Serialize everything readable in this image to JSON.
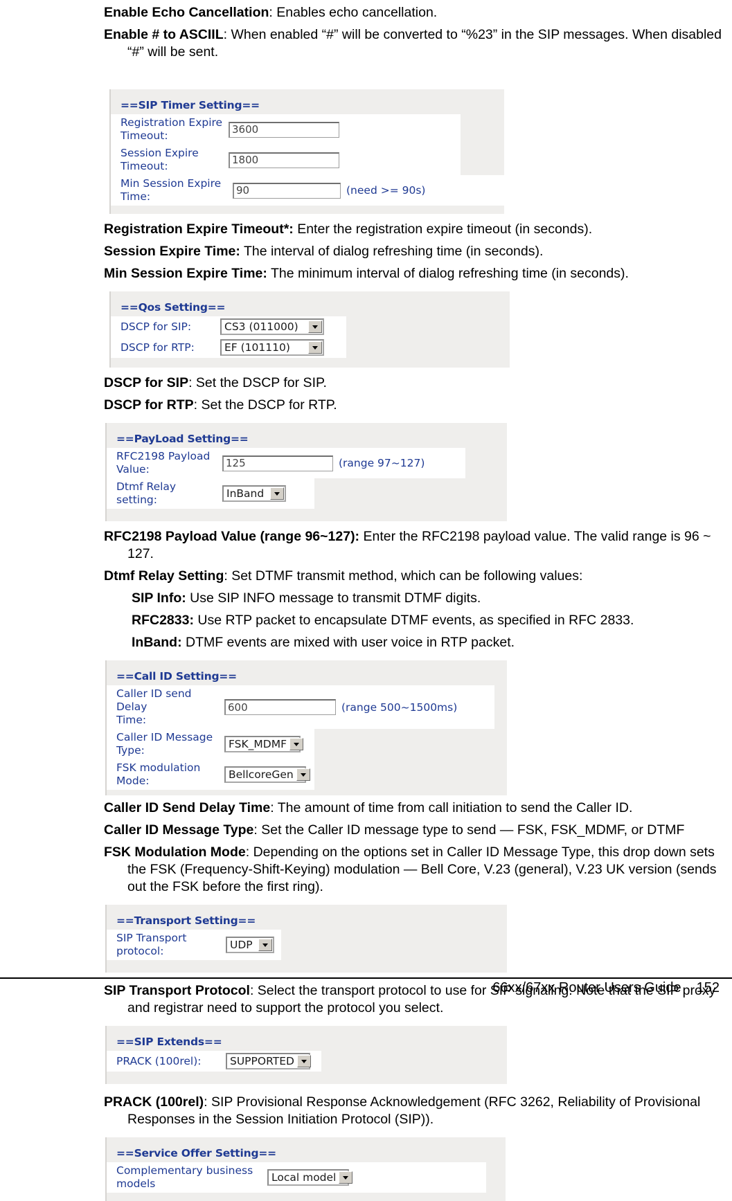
{
  "document": {
    "footer_title": "66xx/67xx Router Users Guide",
    "footer_page": "152"
  },
  "intro": {
    "echo_term": "Enable Echo Cancellation",
    "echo_desc": ": Enables echo cancellation.",
    "ascii_term": "Enable # to ASCIIL",
    "ascii_desc": ": When enabled “#” will be converted to “%23” in the SIP messages. When disabled “#” will be sent."
  },
  "sip_timer_panel": {
    "title": "==SIP Timer Setting==",
    "rows": [
      {
        "label": "Registration Expire\nTimeout:",
        "value": "3600",
        "hint": ""
      },
      {
        "label": "Session Expire Timeout:",
        "value": "1800",
        "hint": ""
      },
      {
        "label": "Min Session Expire Time:",
        "value": "90",
        "hint": "(need >= 90s)"
      }
    ]
  },
  "sip_timer_text": [
    {
      "term": "Registration Expire Timeout*:",
      "desc": " Enter the registration expire timeout (in seconds)."
    },
    {
      "term": "Session Expire Time:",
      "desc": " The interval of dialog refreshing time (in seconds)."
    },
    {
      "term": "Min Session Expire Time:",
      "desc": " The minimum interval of dialog refreshing time (in seconds)."
    }
  ],
  "qos_panel": {
    "title": "==Qos Setting==",
    "rows": [
      {
        "label": "DSCP for SIP:",
        "value": "CS3 (011000)"
      },
      {
        "label": "DSCP for RTP:",
        "value": "EF (101110)"
      }
    ]
  },
  "qos_text": [
    {
      "term": "DSCP for SIP",
      "desc": ": Set the DSCP for SIP."
    },
    {
      "term": "DSCP for RTP",
      "desc": ": Set the DSCP for RTP."
    }
  ],
  "payload_panel": {
    "title": "==PayLoad Setting==",
    "input_row": {
      "label": "RFC2198 Payload Value:",
      "value": "125",
      "hint": "(range 97~127)"
    },
    "select_row": {
      "label": "Dtmf Relay setting:",
      "value": "InBand"
    }
  },
  "payload_text": {
    "rfc_term": "RFC2198 Payload Value (range 96~127):",
    "rfc_desc": " Enter the RFC2198 payload value. The valid range is 96 ~ 127.",
    "dtmf_term": "Dtmf Relay Setting",
    "dtmf_desc": ": Set DTMF transmit method, which can be following values:",
    "options": [
      {
        "term": "SIP Info:",
        "desc": " Use SIP INFO message to transmit DTMF digits."
      },
      {
        "term": "RFC2833:",
        "desc": " Use RTP packet to encapsulate DTMF events, as specified in RFC 2833."
      },
      {
        "term": "InBand:",
        "desc": " DTMF events are mixed with user voice in RTP packet."
      }
    ]
  },
  "callid_panel": {
    "title": "==Call ID Setting==",
    "delay_row": {
      "label": "Caller ID send Delay\nTime:",
      "value": "600",
      "hint": "(range 500~1500ms)"
    },
    "type_row": {
      "label": "Caller ID Message Type:",
      "value": "FSK_MDMF"
    },
    "fsk_row": {
      "label": "FSK modulation Mode:",
      "value": "BellcoreGen"
    }
  },
  "callid_text": [
    {
      "term": "Caller ID Send Delay Time",
      "desc": ": The amount of time from call initiation to send the Caller ID."
    },
    {
      "term": "Caller ID Message Type",
      "desc": ": Set the Caller ID message type to send — FSK, FSK_MDMF, or DTMF"
    },
    {
      "term": "FSK Modulation Mode",
      "desc": ": Depending on the options set in Caller ID Message Type, this drop down sets the FSK (Frequency-Shift-Keying) modulation — Bell Core, V.23 (general), V.23 UK version (sends out the FSK before the first ring)."
    }
  ],
  "transport_panel": {
    "title": "==Transport Setting==",
    "row": {
      "label": "SIP Transport protocol:",
      "value": "UDP"
    }
  },
  "transport_text": {
    "term": "SIP Transport Protocol",
    "desc": ": Select the transport protocol to use for SIP signaling. Note that the SIP proxy and registrar need to support the protocol you select."
  },
  "extends_panel": {
    "title": "==SIP Extends==",
    "row": {
      "label": "PRACK (100rel):",
      "value": "SUPPORTED"
    }
  },
  "extends_text": {
    "term": "PRACK (100rel)",
    "desc": ": SIP Provisional Response Acknowledgement (RFC 3262, Reliability of Provisional Responses in the Session Initiation Protocol (SIP))."
  },
  "service_panel": {
    "title": "==Service Offer Setting==",
    "row": {
      "label": "Complementary business models",
      "value": "Local model"
    }
  },
  "colors": {
    "panel_bg": "#efeeec",
    "label_blue": "#1f3a93",
    "row_bg": "#ffffff",
    "select_button": "#d4d0c8"
  }
}
